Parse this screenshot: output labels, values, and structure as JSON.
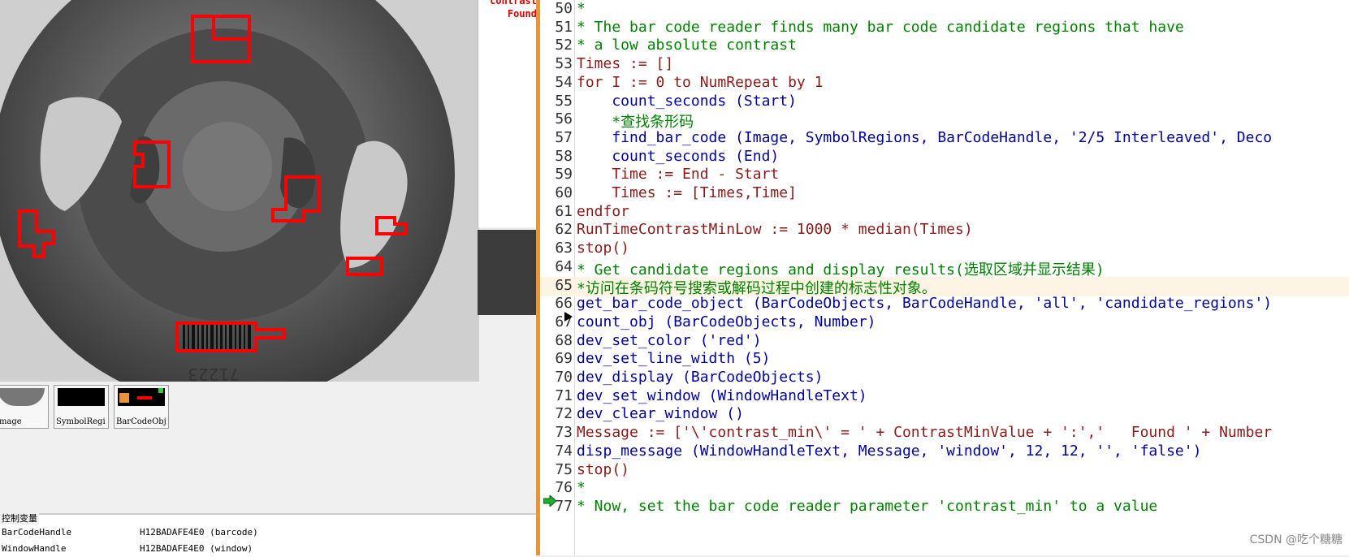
{
  "graphics_window": {
    "barcode_digits": "71223"
  },
  "text_window": {
    "lines": [
      "contrast",
      "Found"
    ]
  },
  "thumbnails": [
    {
      "label": "Image"
    },
    {
      "label": "SymbolRegi"
    },
    {
      "label": "BarCodeObj"
    }
  ],
  "variables": {
    "header": "控制变量",
    "rows": [
      {
        "name": "BarCodeHandle",
        "value": "H12BADAFE4E0 (barcode)"
      },
      {
        "name": "WindowHandle",
        "value": "H12BADAFE4E0 (window)"
      }
    ]
  },
  "editor": {
    "lines": [
      {
        "num": "50",
        "text": "*",
        "kind": "comment"
      },
      {
        "num": "51",
        "text": "* The bar code reader finds many bar code candidate regions that have",
        "kind": "comment"
      },
      {
        "num": "52",
        "text": "* a low absolute contrast",
        "kind": "comment"
      },
      {
        "num": "53",
        "text": "Times := []",
        "kind": "op"
      },
      {
        "num": "54",
        "text": "for I := 0 to NumRepeat by 1",
        "kind": "op"
      },
      {
        "num": "55",
        "text": "    count_seconds (Start)",
        "kind": "call"
      },
      {
        "num": "56",
        "text": "    *查找条形码",
        "kind": "comment"
      },
      {
        "num": "57",
        "text": "    find_bar_code (Image, SymbolRegions, BarCodeHandle, '2/5 Interleaved', Deco",
        "kind": "call"
      },
      {
        "num": "58",
        "text": "    count_seconds (End)",
        "kind": "call"
      },
      {
        "num": "59",
        "text": "    Time := End - Start",
        "kind": "op"
      },
      {
        "num": "60",
        "text": "    Times := [Times,Time]",
        "kind": "op"
      },
      {
        "num": "61",
        "text": "endfor",
        "kind": "op"
      },
      {
        "num": "62",
        "text": "RunTimeContrastMinLow := 1000 * median(Times)",
        "kind": "op"
      },
      {
        "num": "63",
        "text": "stop()",
        "kind": "op"
      },
      {
        "num": "64",
        "text": "* Get candidate regions and display results(选取区域并显示结果)",
        "kind": "comment"
      },
      {
        "num": "65",
        "text": "*访问在条码符号搜索或解码过程中创建的标志性对象。",
        "kind": "comment"
      },
      {
        "num": "66",
        "text": "get_bar_code_object (BarCodeObjects, BarCodeHandle, 'all', 'candidate_regions')",
        "kind": "call"
      },
      {
        "num": "67",
        "text": "count_obj (BarCodeObjects, Number)",
        "kind": "call"
      },
      {
        "num": "68",
        "text": "dev_set_color ('red')",
        "kind": "call"
      },
      {
        "num": "69",
        "text": "dev_set_line_width (5)",
        "kind": "call"
      },
      {
        "num": "70",
        "text": "dev_display (BarCodeObjects)",
        "kind": "call"
      },
      {
        "num": "71",
        "text": "dev_set_window (WindowHandleText)",
        "kind": "call"
      },
      {
        "num": "72",
        "text": "dev_clear_window ()",
        "kind": "call"
      },
      {
        "num": "73",
        "text": "Message := ['\\'contrast_min\\' = ' + ContrastMinValue + ':','   Found ' + Number",
        "kind": "op"
      },
      {
        "num": "74",
        "text": "disp_message (WindowHandleText, Message, 'window', 12, 12, '', 'false')",
        "kind": "call"
      },
      {
        "num": "75",
        "text": "stop()",
        "kind": "op"
      },
      {
        "num": "76",
        "text": "*",
        "kind": "comment"
      },
      {
        "num": "77",
        "text": "* Now, set the bar code reader parameter 'contrast_min' to a value",
        "kind": "comment"
      }
    ]
  },
  "watermark": "CSDN @吃个糖糖",
  "colors": {
    "comment": "#008000",
    "operator": "#8a1a1a",
    "call": "#00009a",
    "region": "#ff0000",
    "splitter": "#e8953a"
  }
}
